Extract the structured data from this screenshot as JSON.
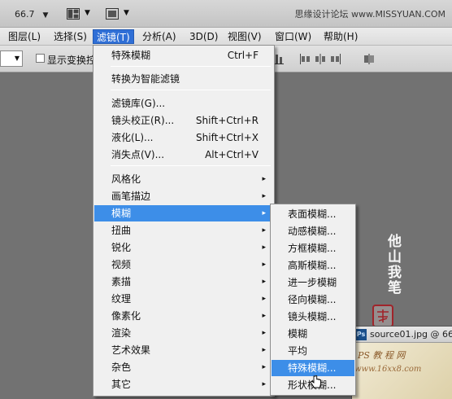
{
  "toolbar": {
    "zoom_value": "66.7",
    "arrange_icon": "arrange-documents-icon",
    "screen_mode_icon": "screen-mode-icon",
    "watermark": "思缘设计论坛 www.MISSYUAN.COM"
  },
  "menubar": {
    "items": [
      {
        "label": "图层(L)"
      },
      {
        "label": "选择(S)"
      },
      {
        "label": "滤镜(T)"
      },
      {
        "label": "分析(A)"
      },
      {
        "label": "3D(D)"
      },
      {
        "label": "视图(V)"
      },
      {
        "label": "窗口(W)"
      },
      {
        "label": "帮助(H)"
      }
    ]
  },
  "options": {
    "show_transform_label": "显示变换控"
  },
  "filter_menu": {
    "items": [
      {
        "label": "特殊模糊",
        "shortcut": "Ctrl+F"
      },
      {
        "label": "转换为智能滤镜",
        "shortcut": ""
      },
      {
        "label": "滤镜库(G)...",
        "shortcut": ""
      },
      {
        "label": "镜头校正(R)...",
        "shortcut": "Shift+Ctrl+R"
      },
      {
        "label": "液化(L)...",
        "shortcut": "Shift+Ctrl+X"
      },
      {
        "label": "消失点(V)...",
        "shortcut": "Alt+Ctrl+V"
      },
      {
        "label": "风格化"
      },
      {
        "label": "画笔描边"
      },
      {
        "label": "模糊"
      },
      {
        "label": "扭曲"
      },
      {
        "label": "锐化"
      },
      {
        "label": "视频"
      },
      {
        "label": "素描"
      },
      {
        "label": "纹理"
      },
      {
        "label": "像素化"
      },
      {
        "label": "渲染"
      },
      {
        "label": "艺术效果"
      },
      {
        "label": "杂色"
      },
      {
        "label": "其它"
      }
    ],
    "submenu_arrow": "▸"
  },
  "blur_menu": {
    "items": [
      {
        "label": "表面模糊..."
      },
      {
        "label": "动感模糊..."
      },
      {
        "label": "方框模糊..."
      },
      {
        "label": "高斯模糊..."
      },
      {
        "label": "进一步模糊"
      },
      {
        "label": "径向模糊..."
      },
      {
        "label": "镜头模糊..."
      },
      {
        "label": "模糊"
      },
      {
        "label": "平均"
      },
      {
        "label": "特殊模糊..."
      },
      {
        "label": "形状模糊..."
      }
    ]
  },
  "document": {
    "title": "source01.jpg @ 66",
    "ps_badge": "Ps"
  },
  "watermarks": {
    "site": "PS 教 程 网",
    "site_url": "www.16xx8.com",
    "seal": "印章"
  },
  "colors": {
    "accent": "#3d8ee8",
    "menu_bg": "#f0f0f0",
    "canvas": "#727272"
  }
}
